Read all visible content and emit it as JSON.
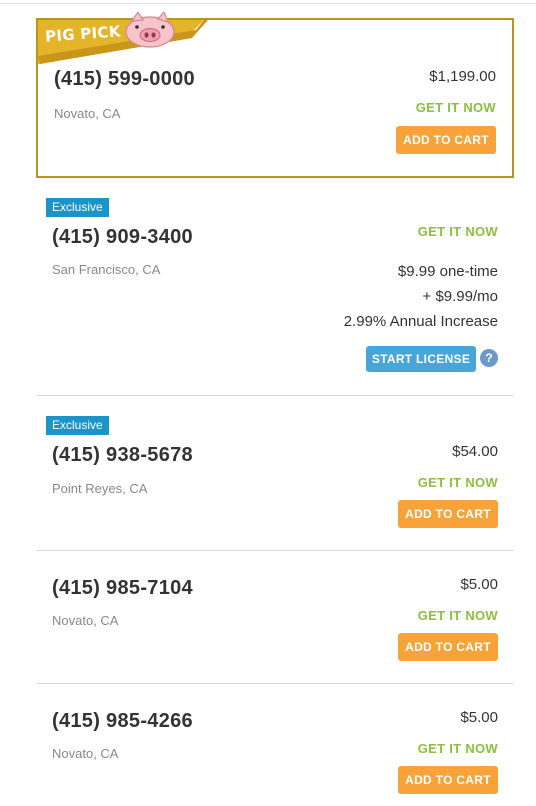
{
  "pig_pick": {
    "ribbon_label": "PIG PICK",
    "icon": "pig-face-icon",
    "phone": "(415) 599-0000",
    "city": "Novato, CA",
    "price": "$1,199.00",
    "availability": "GET IT NOW",
    "cart_button": "ADD TO CART"
  },
  "listing_2": {
    "badge": "Exclusive",
    "phone": "(415) 909-3400",
    "city": "San Francisco, CA",
    "availability": "GET IT NOW",
    "price_line_1": "$9.99 one-time",
    "price_line_2": "+ $9.99/mo",
    "price_line_3": "2.99% Annual Increase",
    "license_button": "START LICENSE",
    "help_icon": "?"
  },
  "listing_3": {
    "badge": "Exclusive",
    "phone": "(415) 938-5678",
    "city": "Point Reyes, CA",
    "price": "$54.00",
    "availability": "GET IT NOW",
    "cart_button": "ADD TO CART"
  },
  "listing_4": {
    "phone": "(415) 985-7104",
    "city": "Novato, CA",
    "price": "$5.00",
    "availability": "GET IT NOW",
    "cart_button": "ADD TO CART"
  },
  "listing_5": {
    "phone": "(415) 985-4266",
    "city": "Novato, CA",
    "price": "$5.00",
    "availability": "GET IT NOW",
    "cart_button": "ADD TO CART"
  },
  "colors": {
    "accent_orange": "#f7a33a",
    "get_now_green": "#8cbf3f",
    "license_blue": "#46a5d9",
    "badge_blue": "#1b95c8",
    "pig_pick_gold": "#b8961e"
  }
}
